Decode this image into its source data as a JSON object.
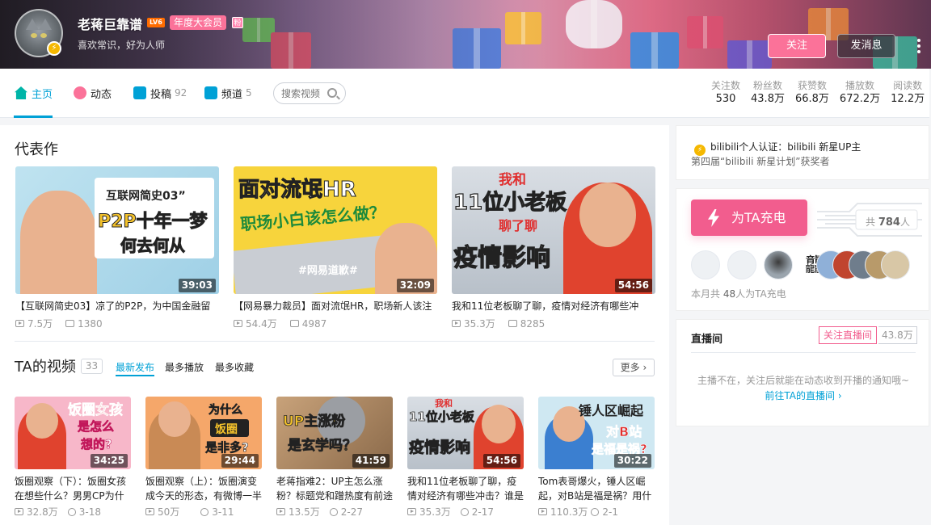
{
  "profile": {
    "name": "老蒋巨靠谱",
    "level_badge": "LV6",
    "vip_label": "年度大会员",
    "fan_badge": "粉",
    "verify_glyph": "⚡",
    "signature": "喜欢常识，好为人师",
    "follow_label": "关注",
    "message_label": "发消息",
    "more_glyph": "⋮"
  },
  "nav": {
    "items": [
      {
        "label": "主页",
        "count": "",
        "icon": "home-icon"
      },
      {
        "label": "动态",
        "count": "",
        "icon": "dynamic-icon"
      },
      {
        "label": "投稿",
        "count": "92",
        "icon": "upload-icon"
      },
      {
        "label": "频道",
        "count": "5",
        "icon": "channel-icon"
      }
    ],
    "search_placeholder": "搜索视频",
    "stats": [
      {
        "label": "关注数",
        "value": "530"
      },
      {
        "label": "粉丝数",
        "value": "43.8万"
      },
      {
        "label": "获赞数",
        "value": "66.8万"
      },
      {
        "label": "播放数",
        "value": "672.2万"
      },
      {
        "label": "阅读数",
        "value": "12.2万"
      }
    ]
  },
  "masterpieces": {
    "title": "代表作",
    "items": [
      {
        "title": "【互联网简史03】凉了的P2P，为中国金融留",
        "duration": "39:03",
        "views": "7.5万",
        "danmaku": "1380",
        "cover_line1": "互联网简史03”",
        "cover_line2": "P2P十年一梦",
        "cover_line3": "何去何从"
      },
      {
        "title": "【网易暴力裁员】面对流氓HR，职场新人该注",
        "duration": "32:09",
        "views": "54.4万",
        "danmaku": "4987",
        "cover_line1": "面对流氓HR",
        "cover_line2": "职场小白该怎么做？",
        "cover_line3": "#网易道歉#"
      },
      {
        "title": "我和11位老板聊了聊，疫情对经济有哪些冲",
        "duration": "54:56",
        "views": "35.3万",
        "danmaku": "8285",
        "cover_line1": "我和",
        "cover_line2": "11位小老板",
        "cover_line3": "聊了聊",
        "cover_line4": "疫情影响"
      }
    ]
  },
  "videos": {
    "title": "TA的视频",
    "count": "33",
    "tabs": [
      "最新发布",
      "最多播放",
      "最多收藏"
    ],
    "more_label": "更多",
    "items": [
      {
        "title": "饭圈观察（下）：饭圈女孩在想些什么？男男CP为什",
        "duration": "34:25",
        "views": "32.8万",
        "date": "3-18",
        "cover_line1": "饭圈女孩",
        "cover_line2": "是怎么",
        "cover_line3": "想的?"
      },
      {
        "title": "饭圈观察（上）：饭圈演变成今天的形态，有微博一半",
        "duration": "29:44",
        "views": "50万",
        "date": "3-11",
        "cover_line1": "为什么",
        "cover_line2": "饭圈",
        "cover_line3": "是非多?"
      },
      {
        "title": "老蒋指难2：UP主怎么涨粉？标题党和蹭热度有前途",
        "duration": "41:59",
        "views": "13.5万",
        "date": "2-27",
        "cover_line1": "UP主涨粉",
        "cover_line2": "是玄学吗？"
      },
      {
        "title": "我和11位老板聊了聊，疫情对经济有哪些冲击？谁是",
        "duration": "54:56",
        "views": "35.3万",
        "date": "2-17",
        "cover_line1": "我和",
        "cover_line2": "11位小老板",
        "cover_line3": "疫情影响"
      },
      {
        "title": "Tom表哥爆火，锤人区崛起，对B站是福是祸？用什",
        "duration": "30:22",
        "views": "110.3万",
        "date": "2-1",
        "cover_line1": "锤人区崛起",
        "cover_line2": "对B站",
        "cover_line3": "是福是祸?"
      }
    ]
  },
  "sidebar": {
    "certification": "bilibili个人认证：bilibili 新星UP主",
    "award": "第四届“bilibili 新星计划”获奖者",
    "charge": {
      "button_label": "为TA充电",
      "total_prefix": "共",
      "total_count": "784",
      "total_suffix": "人",
      "avatar_glyph": "龘",
      "month_prefix": "本月共",
      "month_count": "48",
      "month_suffix": "人为TA充电"
    },
    "live": {
      "title": "直播间",
      "follow_label": "关注直播间",
      "follower_count": "43.8万",
      "tip": "主播不在，关注后就能在动态收到开播的通知哦~",
      "link": "前往TA的直播间",
      "link_arrow": "›"
    }
  }
}
